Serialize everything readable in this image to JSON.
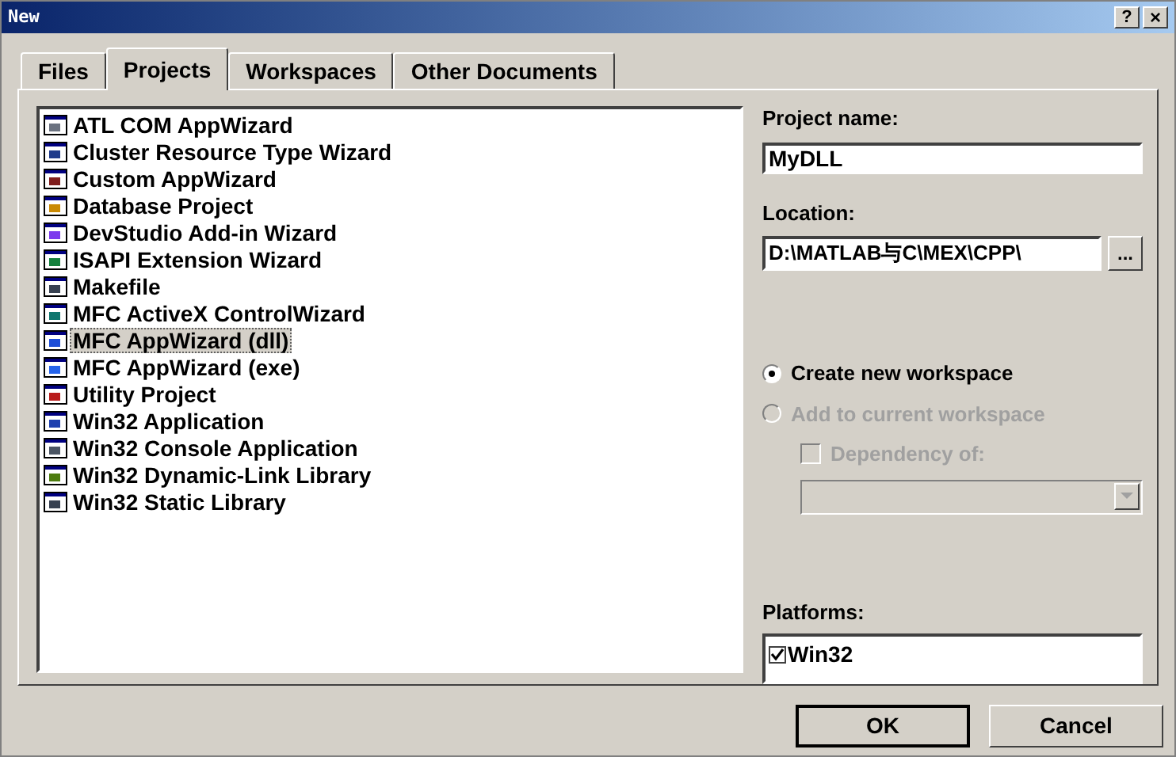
{
  "window": {
    "title": "New",
    "help_button": "?",
    "close_button": "×"
  },
  "tabs": [
    {
      "label": "Files",
      "selected": false
    },
    {
      "label": "Projects",
      "selected": true
    },
    {
      "label": "Workspaces",
      "selected": false
    },
    {
      "label": "Other Documents",
      "selected": false
    }
  ],
  "project_types": [
    {
      "label": "ATL COM AppWizard",
      "selected": false
    },
    {
      "label": "Cluster Resource Type Wizard",
      "selected": false
    },
    {
      "label": "Custom AppWizard",
      "selected": false
    },
    {
      "label": "Database Project",
      "selected": false
    },
    {
      "label": "DevStudio Add-in Wizard",
      "selected": false
    },
    {
      "label": "ISAPI Extension Wizard",
      "selected": false
    },
    {
      "label": "Makefile",
      "selected": false
    },
    {
      "label": "MFC ActiveX ControlWizard",
      "selected": false
    },
    {
      "label": "MFC AppWizard (dll)",
      "selected": true
    },
    {
      "label": "MFC AppWizard (exe)",
      "selected": false
    },
    {
      "label": "Utility Project",
      "selected": false
    },
    {
      "label": "Win32 Application",
      "selected": false
    },
    {
      "label": "Win32 Console Application",
      "selected": false
    },
    {
      "label": "Win32 Dynamic-Link Library",
      "selected": false
    },
    {
      "label": "Win32 Static Library",
      "selected": false
    }
  ],
  "project_name": {
    "label": "Project name:",
    "value": "MyDLL"
  },
  "location": {
    "label": "Location:",
    "value": "D:\\MATLAB与C\\MEX\\CPP\\",
    "browse_button": "..."
  },
  "workspace_options": [
    {
      "label": "Create new workspace",
      "selected": true,
      "disabled": false
    },
    {
      "label": "Add to current workspace",
      "selected": false,
      "disabled": true
    }
  ],
  "dependency": {
    "label": "Dependency of:",
    "checked": false,
    "disabled": true
  },
  "platforms": {
    "label": "Platforms:",
    "items": [
      {
        "label": "Win32",
        "checked": true
      }
    ]
  },
  "buttons": [
    "OK",
    "Cancel"
  ]
}
